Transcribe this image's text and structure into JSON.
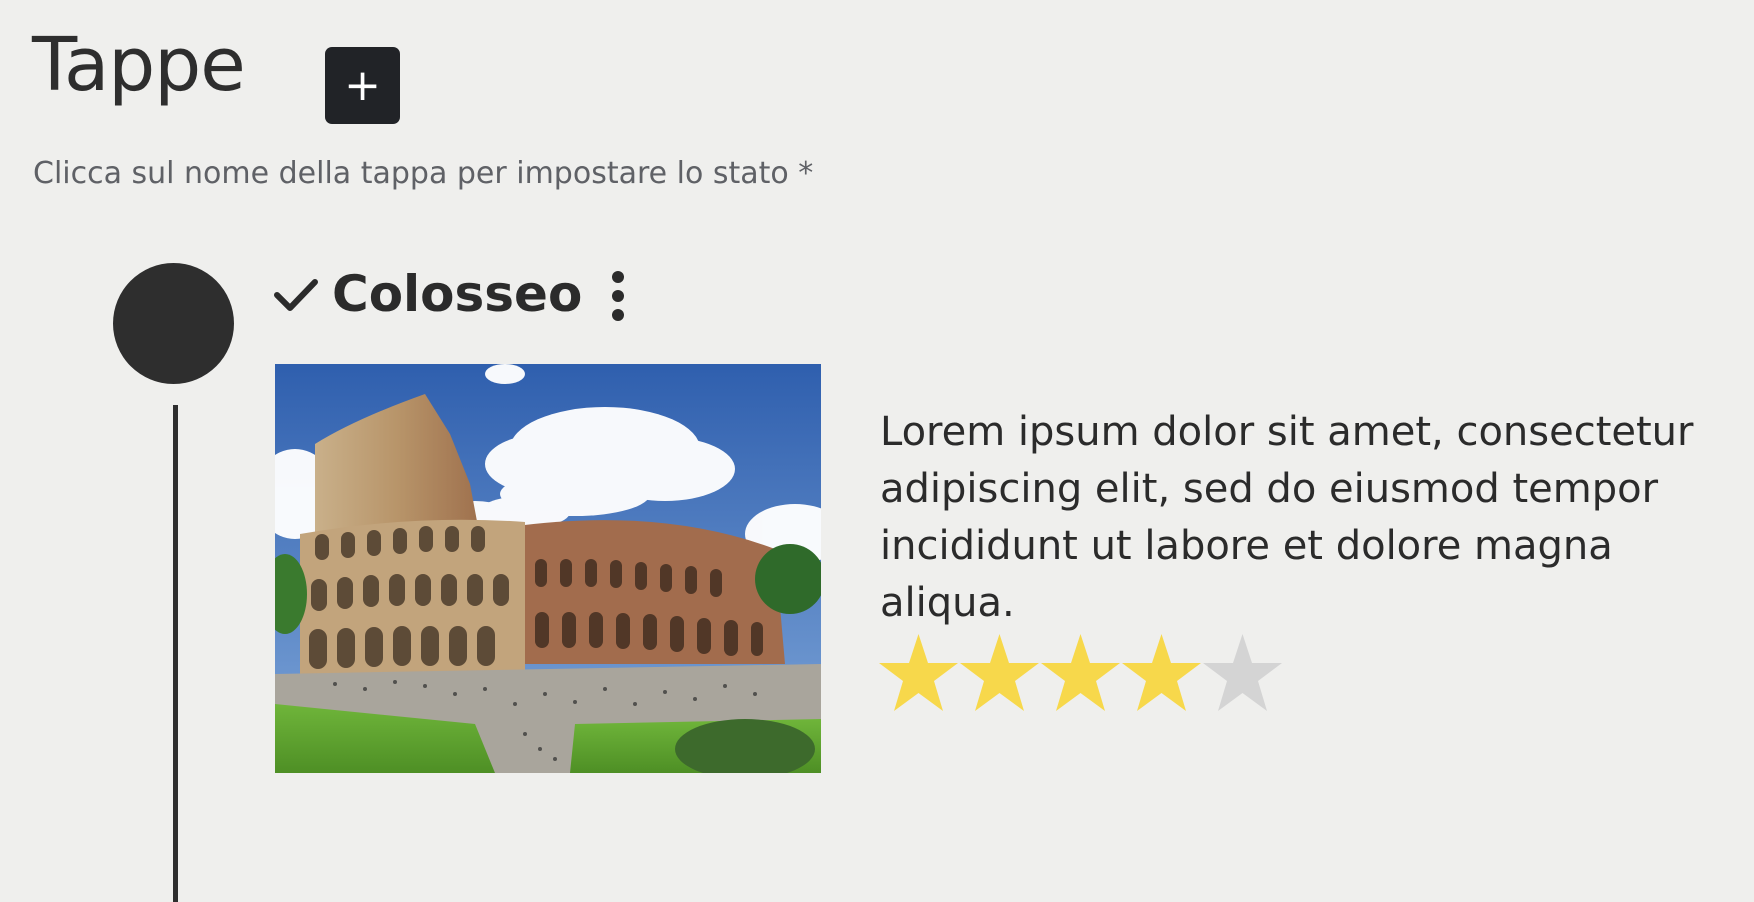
{
  "header": {
    "title": "Tappe",
    "add_button_label": "+",
    "subtitle": "Clicca sul nome della tappa per impostare lo stato *"
  },
  "stops": [
    {
      "name": "Colosseo",
      "status_icon": "check-icon",
      "menu_icon": "kebab-menu-icon",
      "description": "Lorem ipsum dolor sit amet, consectetur adipiscing elit, sed do eiusmod tempor incididunt ut labore et dolore magna aliqua.",
      "rating": 4,
      "rating_max": 5
    }
  ],
  "colors": {
    "background": "#efefed",
    "button": "#212327",
    "timeline": "#2e2e2e",
    "star_filled": "#f7d84b",
    "star_empty": "#d4d4d4"
  }
}
